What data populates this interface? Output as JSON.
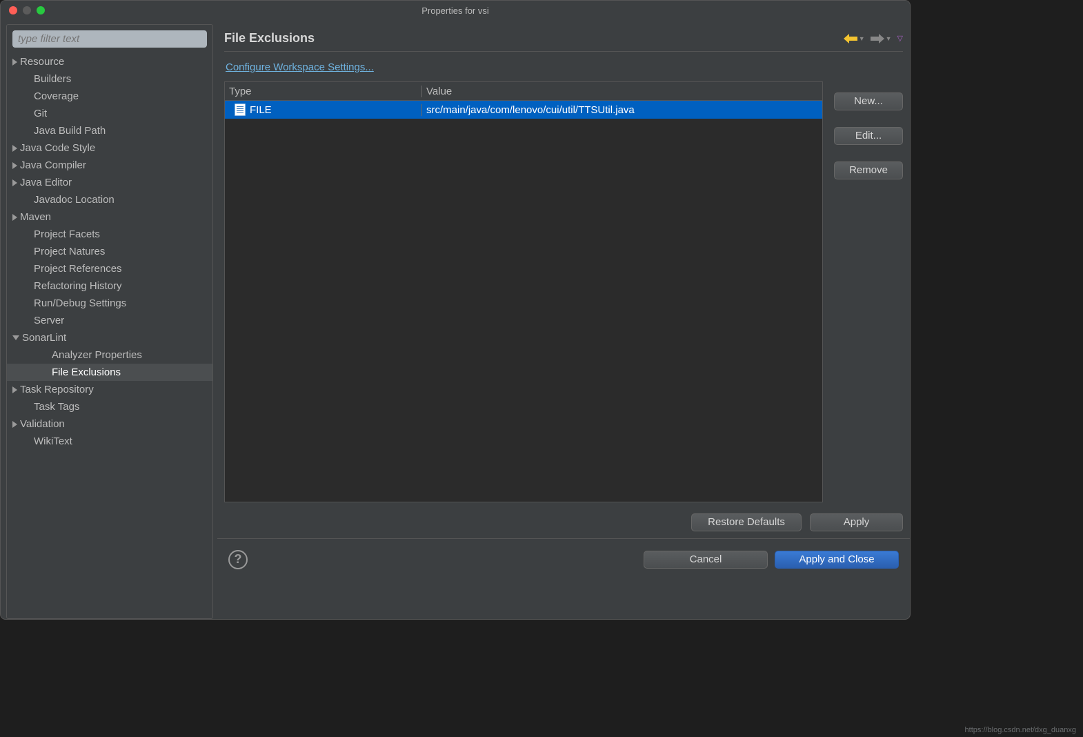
{
  "window": {
    "title": "Properties for vsi"
  },
  "sidebar": {
    "filter_placeholder": "type filter text",
    "items": [
      {
        "label": "Resource",
        "arrow": "right",
        "level": 0
      },
      {
        "label": "Builders",
        "arrow": "",
        "level": 1
      },
      {
        "label": "Coverage",
        "arrow": "",
        "level": 1
      },
      {
        "label": "Git",
        "arrow": "",
        "level": 1
      },
      {
        "label": "Java Build Path",
        "arrow": "",
        "level": 1
      },
      {
        "label": "Java Code Style",
        "arrow": "right",
        "level": 0
      },
      {
        "label": "Java Compiler",
        "arrow": "right",
        "level": 0
      },
      {
        "label": "Java Editor",
        "arrow": "right",
        "level": 0
      },
      {
        "label": "Javadoc Location",
        "arrow": "",
        "level": 1
      },
      {
        "label": "Maven",
        "arrow": "right",
        "level": 0
      },
      {
        "label": "Project Facets",
        "arrow": "",
        "level": 1
      },
      {
        "label": "Project Natures",
        "arrow": "",
        "level": 1
      },
      {
        "label": "Project References",
        "arrow": "",
        "level": 1
      },
      {
        "label": "Refactoring History",
        "arrow": "",
        "level": 1
      },
      {
        "label": "Run/Debug Settings",
        "arrow": "",
        "level": 1
      },
      {
        "label": "Server",
        "arrow": "",
        "level": 1
      },
      {
        "label": "SonarLint",
        "arrow": "down",
        "level": 0
      },
      {
        "label": "Analyzer Properties",
        "arrow": "",
        "level": 2
      },
      {
        "label": "File Exclusions",
        "arrow": "",
        "level": 2,
        "selected": true
      },
      {
        "label": "Task Repository",
        "arrow": "right",
        "level": 0
      },
      {
        "label": "Task Tags",
        "arrow": "",
        "level": 1
      },
      {
        "label": "Validation",
        "arrow": "right",
        "level": 0
      },
      {
        "label": "WikiText",
        "arrow": "",
        "level": 1
      }
    ]
  },
  "main": {
    "title": "File Exclusions",
    "config_link": "Configure Workspace Settings...",
    "columns": {
      "type": "Type",
      "value": "Value"
    },
    "rows": [
      {
        "type": "FILE",
        "value": "src/main/java/com/lenovo/cui/util/TTSUtil.java",
        "selected": true
      }
    ],
    "side_buttons": {
      "new": "New...",
      "edit": "Edit...",
      "remove": "Remove"
    },
    "footer_top": {
      "restore": "Restore Defaults",
      "apply": "Apply"
    },
    "footer_bottom": {
      "cancel": "Cancel",
      "apply_close": "Apply and Close"
    }
  },
  "watermark": "https://blog.csdn.net/dxg_duanxg"
}
